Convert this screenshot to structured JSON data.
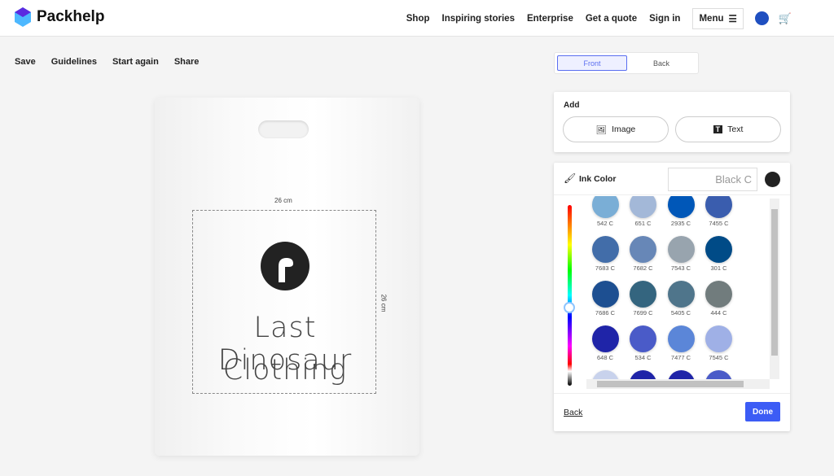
{
  "header": {
    "brand": "Packhelp",
    "nav": [
      "Shop",
      "Inspiring stories",
      "Enterprise",
      "Get a quote",
      "Sign in"
    ],
    "menu": "Menu"
  },
  "toolbar": [
    "Save",
    "Guidelines",
    "Start again",
    "Share"
  ],
  "sides": {
    "front": "Front",
    "back": "Back"
  },
  "canvas": {
    "width_label": "26 cm",
    "height_label": "26 cm",
    "line1": "Last Dinosaur",
    "line2": "Clothing"
  },
  "add": {
    "title": "Add",
    "image": "Image",
    "text": "Text"
  },
  "ink": {
    "title": "Ink Color",
    "value": "Black C",
    "current_color": "#222222",
    "swatches": [
      {
        "label": "542 C",
        "color": "#7aaed6"
      },
      {
        "label": "651 C",
        "color": "#a3b8d8"
      },
      {
        "label": "2935 C",
        "color": "#0057b8"
      },
      {
        "label": "7455 C",
        "color": "#3a5dae"
      },
      {
        "label": "7683 C",
        "color": "#426da9"
      },
      {
        "label": "7682 C",
        "color": "#6787b7"
      },
      {
        "label": "7543 C",
        "color": "#98a4ae"
      },
      {
        "label": "301 C",
        "color": "#004b87"
      },
      {
        "label": "7686 C",
        "color": "#1d4f91"
      },
      {
        "label": "7699 C",
        "color": "#34657f"
      },
      {
        "label": "5405 C",
        "color": "#4f758b"
      },
      {
        "label": "444 C",
        "color": "#717c7d"
      },
      {
        "label": "648 C",
        "color": "#1f24a8"
      },
      {
        "label": "534 C",
        "color": "#4a5bc8"
      },
      {
        "label": "7477 C",
        "color": "#5b86d8"
      },
      {
        "label": "7545 C",
        "color": "#9fb0e6"
      },
      {
        "label": "",
        "color": "#c8d2ec"
      },
      {
        "label": "",
        "color": "#1f24a8"
      },
      {
        "label": "",
        "color": "#1f24a8"
      },
      {
        "label": "",
        "color": "#4a5bc8"
      }
    ]
  },
  "footer": {
    "back": "Back",
    "done": "Done"
  }
}
